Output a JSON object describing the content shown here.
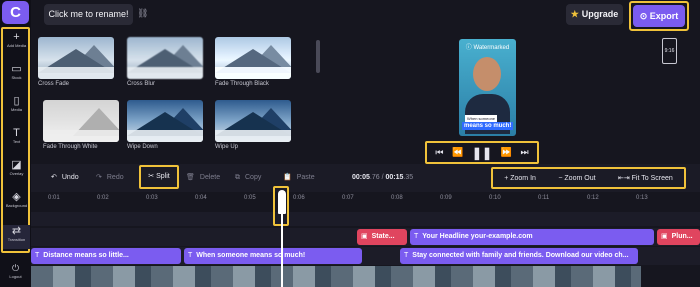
{
  "app": {
    "logo_letter": "C"
  },
  "sidebar": {
    "items": [
      {
        "icon": "+",
        "label": "Add Media"
      },
      {
        "icon": "▭",
        "label": "Stock"
      },
      {
        "icon": "▯",
        "label": "Media"
      },
      {
        "icon": "T",
        "label": "Text"
      },
      {
        "icon": "◪",
        "label": "Overlay"
      },
      {
        "icon": "◈",
        "label": "Background"
      },
      {
        "icon": "⇄",
        "label": "Transition"
      }
    ],
    "bottom": {
      "icon": "⏻",
      "label": "Logout"
    }
  },
  "topbar": {
    "project_name": "Click me to rename!",
    "upgrade_label": "Upgrade",
    "export_label": "Export"
  },
  "transitions": [
    {
      "name": "Cross Fade",
      "style": "normal"
    },
    {
      "name": "Cross Blur",
      "style": "blur"
    },
    {
      "name": "Fade Through Black",
      "style": "normal"
    },
    {
      "name": "Fade Through White",
      "style": "bw"
    },
    {
      "name": "Wipe Down",
      "style": "blue"
    },
    {
      "name": "Wipe Up",
      "style": "blue"
    }
  ],
  "preview": {
    "watermark": "Watermarked",
    "caption_line1": "When someone",
    "caption_line2": "means so much!",
    "aspect_ratio": "9:16"
  },
  "toolbar": {
    "undo": "Undo",
    "redo": "Redo",
    "split": "Split",
    "delete": "Delete",
    "copy": "Copy",
    "paste": "Paste",
    "current_time": "00:05",
    "current_time_frac": ".76",
    "separator": " / ",
    "total_time": "00:15",
    "total_time_frac": ".35",
    "zoom_in": "Zoom In",
    "zoom_out": "Zoom Out",
    "fit": "Fit To Screen"
  },
  "ruler_ticks": [
    "0:01",
    "0:02",
    "0:03",
    "0:04",
    "0:05",
    "0:06",
    "0:07",
    "0:08",
    "0:09",
    "0:10",
    "0:11",
    "0:12",
    "0:13"
  ],
  "timeline": {
    "row1": [
      {
        "label": "State...",
        "color": "red"
      },
      {
        "label": "Your Headline your-example.com",
        "color": "purple"
      },
      {
        "label": "Plun...",
        "color": "red"
      }
    ],
    "row2": [
      {
        "label": "Distance means so little...",
        "color": "purple"
      },
      {
        "label": "When someone means so much!",
        "color": "purple"
      },
      {
        "label": "Stay connected with family and friends. Download our video ch...",
        "color": "purple"
      }
    ]
  }
}
